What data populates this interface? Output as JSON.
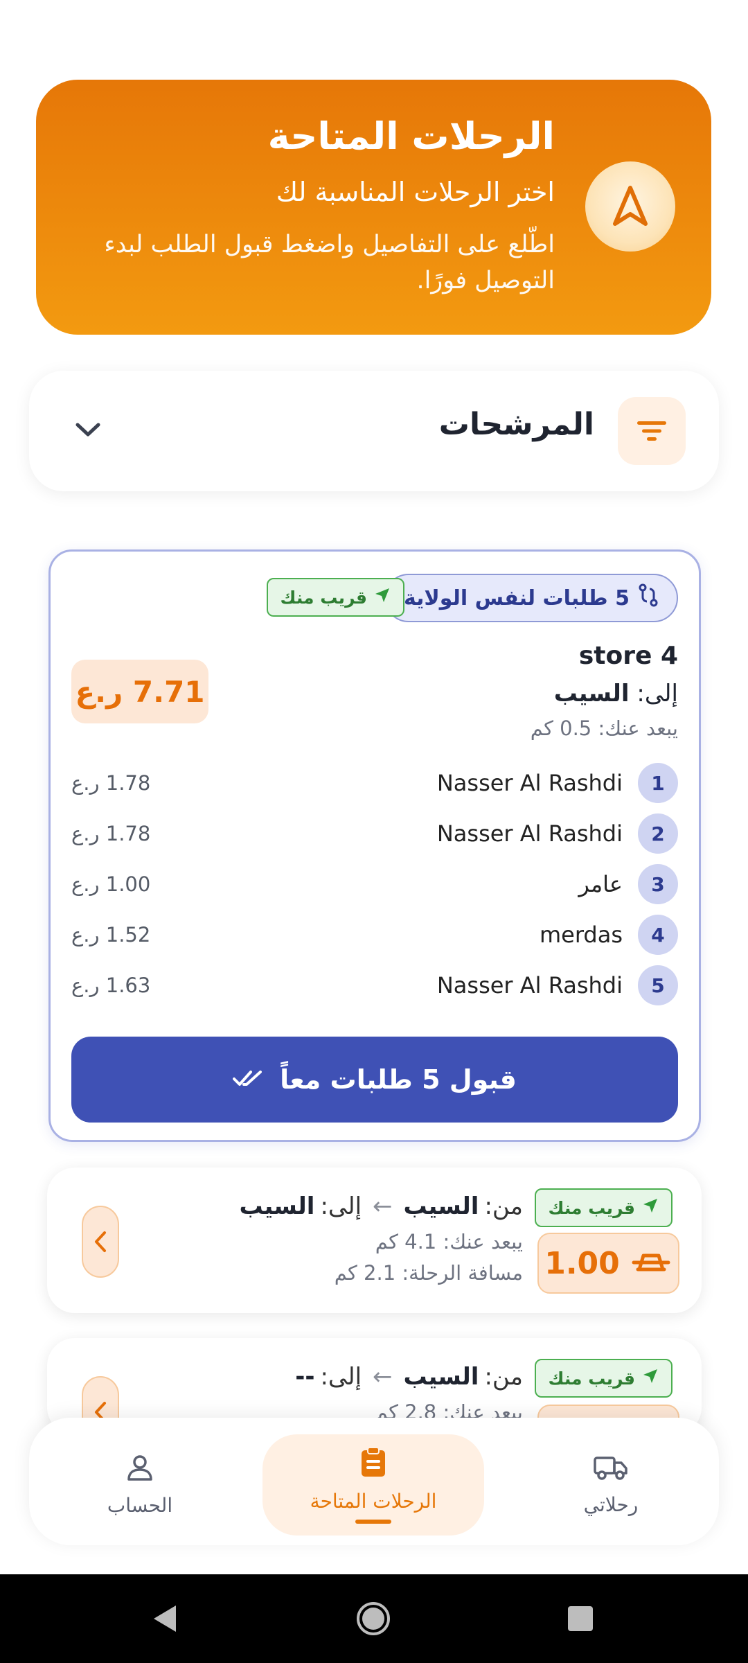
{
  "header": {
    "title": "الرحلات المتاحة",
    "subtitle": "اختر الرحلات المناسبة لك",
    "description": "اطّلع على التفاصيل واضغط قبول الطلب لبدء التوصيل فورًا.",
    "icon": "navigation-arrow-icon"
  },
  "filters": {
    "title": "المرشحات",
    "icon": "filter-icon",
    "toggle_icon": "chevron-down-icon"
  },
  "group": {
    "badge": "5 طلبات لنفس الولاية",
    "badge_icon": "route-icon",
    "near_badge": "قريب منك",
    "store": "store 4",
    "to_label": "إلى:",
    "to_value": "السيب",
    "distance": "يبعد عنك: 0.5 كم",
    "total": "7.71 ر.ع",
    "orders": [
      {
        "num": "1",
        "name": "Nasser Al Rashdi",
        "price": "1.78 ر.ع"
      },
      {
        "num": "2",
        "name": "Nasser Al Rashdi",
        "price": "1.78 ر.ع"
      },
      {
        "num": "3",
        "name": "عامر",
        "price": "1.00 ر.ع"
      },
      {
        "num": "4",
        "name": "merdas",
        "price": "1.52 ر.ع"
      },
      {
        "num": "5",
        "name": "Nasser Al Rashdi",
        "price": "1.63 ر.ع"
      }
    ],
    "accept_label": "قبول 5 طلبات معاً"
  },
  "trips": [
    {
      "near_badge": "قريب منك",
      "from_label": "من:",
      "from_value": "السيب",
      "to_label": "إلى:",
      "to_value": "السيب",
      "distance": "يبعد عنك: 4.1 كم",
      "trip_distance": "مسافة الرحلة: 2.1 كم",
      "price": "1.00"
    },
    {
      "near_badge": "قريب منك",
      "from_label": "من:",
      "from_value": "السيب",
      "to_label": "إلى:",
      "to_value": "--",
      "distance": "يبعد عنك: 2.8 كم"
    }
  ],
  "nav": {
    "account": "الحساب",
    "available": "الرحلات المتاحة",
    "my_trips": "رحلاتي"
  },
  "colors": {
    "accent": "#e67708",
    "primary": "#3f51b5",
    "success": "#4caf50"
  }
}
